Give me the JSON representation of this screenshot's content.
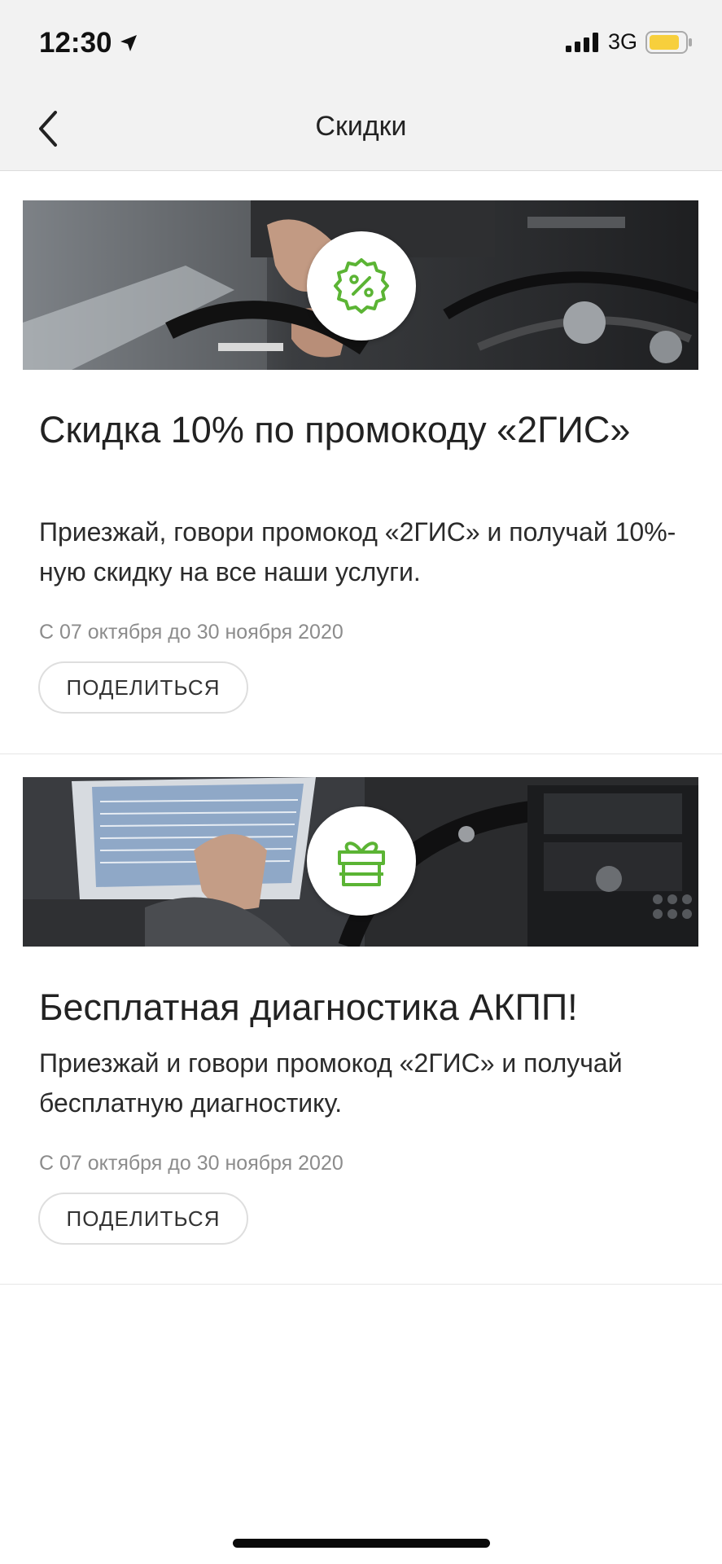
{
  "status_bar": {
    "time": "12:30",
    "network": "3G"
  },
  "nav": {
    "title": "Скидки"
  },
  "offers": [
    {
      "title": "Скидка 10% по промокоду «2ГИС»",
      "description": "Приезжай, говори промокод «2ГИС» и получай 10%-ную скидку на все наши услуги.",
      "date": "С 07 октября до 30 ноября 2020",
      "share_label": "ПОДЕЛИТЬСЯ",
      "badge_icon": "percent-badge-icon"
    },
    {
      "title": "Бесплатная диагностика АКПП!",
      "description": "Приезжай и говори промокод «2ГИС» и получай бесплатную диагностику.",
      "date": "С 07 октября до 30 ноября 2020",
      "share_label": "ПОДЕЛИТЬСЯ",
      "badge_icon": "gift-icon"
    }
  ],
  "colors": {
    "accent_green": "#5bb434",
    "battery_yellow": "#f7cf3c"
  }
}
